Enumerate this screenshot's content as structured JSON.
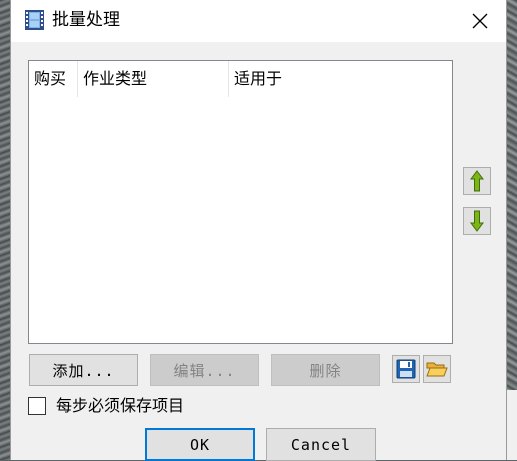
{
  "window": {
    "title": "批量处理",
    "close_label": "×"
  },
  "list": {
    "columns": [
      "购买",
      "作业类型",
      "适用于"
    ],
    "rows": []
  },
  "buttons": {
    "add": "添加...",
    "edit": "编辑...",
    "delete": "删除",
    "ok": "OK",
    "cancel": "Cancel"
  },
  "checkbox": {
    "label": "每步必须保存项目",
    "checked": false
  },
  "icons": {
    "title": "film-strip-icon",
    "move_up": "arrow-up-icon",
    "move_down": "arrow-down-icon",
    "save": "floppy-disk-icon",
    "open": "folder-open-icon"
  },
  "colors": {
    "accent": "#0078d7",
    "arrow_green": "#7cb518",
    "disabled_text": "#838383"
  }
}
